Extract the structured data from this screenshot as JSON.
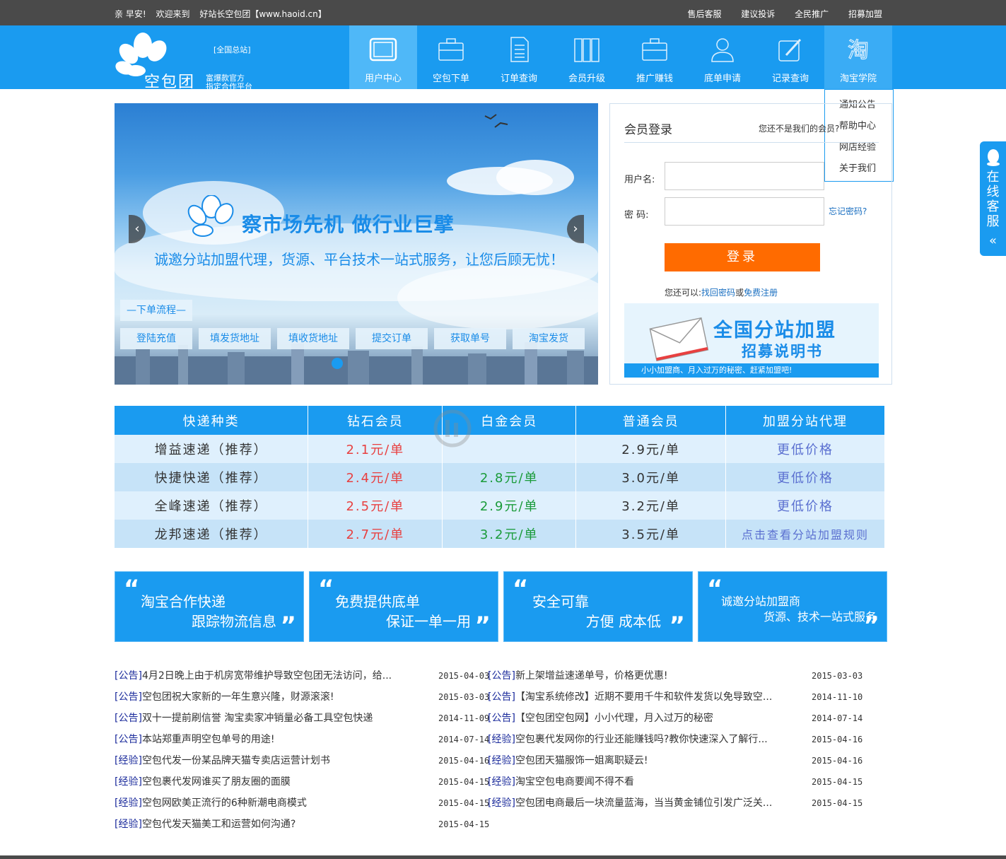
{
  "topbar": {
    "greet": [
      "亲 早安!",
      "欢迎来到",
      "好站长空包团【www.haoid.cn】"
    ],
    "links": [
      "售后客服",
      "建议投诉",
      "全民推广",
      "招募加盟"
    ]
  },
  "logo": {
    "station": "[全国总站]",
    "brand": "空包团",
    "slogan1": "富爆款官方",
    "slogan2": "指定合作平台"
  },
  "nav": [
    {
      "label": "用户中心",
      "icon": "tablet-icon"
    },
    {
      "label": "空包下单",
      "icon": "briefcase-icon"
    },
    {
      "label": "订单查询",
      "icon": "document-icon"
    },
    {
      "label": "会员升级",
      "icon": "books-icon"
    },
    {
      "label": "推广赚钱",
      "icon": "briefcase-icon"
    },
    {
      "label": "底单申请",
      "icon": "user-icon"
    },
    {
      "label": "记录查询",
      "icon": "pen-icon"
    },
    {
      "label": "淘宝学院",
      "icon": "taobao-icon"
    }
  ],
  "dropdown": [
    "通知公告",
    "帮助中心",
    "网店经验",
    "关于我们"
  ],
  "banner": {
    "headline": "察市场先机 做行业巨擘",
    "sub": "诚邀分站加盟代理，货源、平台技术一站式服务，让您后顾无忧！",
    "process_title": "—下单流程—",
    "steps": [
      "登陆充值",
      "填发货地址",
      "填收货地址",
      "提交订单",
      "获取单号",
      "淘宝发货"
    ]
  },
  "login": {
    "title": "会员登录",
    "notyet": "您还不是我们的会员?",
    "username_label": "用户名:",
    "password_label": "密  码:",
    "forgot": "忘记密码?",
    "button": "登录",
    "alt_prefix": "您还可以:",
    "alt_link1": "找回密码",
    "alt_or": "或",
    "alt_link2": "免费注册",
    "promo_t1": "全国分站加盟",
    "promo_t2": "招募说明书",
    "promo_strip": "小小加盟商、月入过万的秘密、赶紧加盟吧!"
  },
  "service": {
    "text": "在线客服",
    "chevron": "«"
  },
  "price_table": {
    "headers": [
      "快递种类",
      "钻石会员",
      "白金会员",
      "普通会员",
      "加盟分站代理"
    ],
    "rows": [
      [
        "增益速递（推荐）",
        "2.1元/单",
        "",
        "2.9元/单",
        "更低价格"
      ],
      [
        "快捷快递（推荐）",
        "2.4元/单",
        "2.8元/单",
        "3.0元/单",
        "更低价格"
      ],
      [
        "全峰速递（推荐）",
        "2.5元/单",
        "2.9元/单",
        "3.2元/单",
        "更低价格"
      ],
      [
        "龙邦速递（推荐）",
        "2.7元/单",
        "3.2元/单",
        "3.5元/单",
        "点击查看分站加盟规则"
      ]
    ]
  },
  "features": [
    {
      "l1": "淘宝合作快递",
      "l2": "跟踪物流信息"
    },
    {
      "l1": "免费提供底单",
      "l2": "保证一单一用"
    },
    {
      "l1": "安全可靠",
      "l2": "方便 成本低"
    },
    {
      "l1": "诚邀分站加盟商",
      "l2": "货源、技术一站式服务"
    }
  ],
  "news_left": [
    {
      "tag": "[公告]",
      "text": "4月2日晚上由于机房宽带维护导致空包团无法访问，给...",
      "date": "2015-04-03"
    },
    {
      "tag": "[公告]",
      "text": "空包团祝大家新的一年生意兴隆，财源滚滚!",
      "date": "2015-03-03"
    },
    {
      "tag": "[公告]",
      "text": "双十一提前刷信誉 淘宝卖家冲销量必备工具空包快递",
      "date": "2014-11-09"
    },
    {
      "tag": "[公告]",
      "text": "本站郑重声明空包单号的用途!",
      "date": "2014-07-14"
    },
    {
      "tag": "[经验]",
      "text": "空包代发一份某品牌天猫专卖店运营计划书",
      "date": "2015-04-16"
    },
    {
      "tag": "[经验]",
      "text": "空包裹代发网谁买了朋友圈的面膜",
      "date": "2015-04-15"
    },
    {
      "tag": "[经验]",
      "text": "空包网欧美正流行的6种新潮电商模式",
      "date": "2015-04-15"
    },
    {
      "tag": "[经验]",
      "text": "空包代发天猫美工和运营如何沟通?",
      "date": "2015-04-15"
    }
  ],
  "news_right": [
    {
      "tag": "[公告]",
      "text": "新上架增益速递单号，价格更优惠!",
      "date": "2015-03-03"
    },
    {
      "tag": "[公告]",
      "text": "【淘宝系统修改】近期不要用千牛和软件发货以免导致空...",
      "date": "2014-11-10"
    },
    {
      "tag": "[公告]",
      "text": "【空包团空包网】小小代理，月入过万的秘密",
      "date": "2014-07-14"
    },
    {
      "tag": "[经验]",
      "text": "空包裹代发网你的行业还能赚钱吗?教你快速深入了解行...",
      "date": "2015-04-16"
    },
    {
      "tag": "[经验]",
      "text": "空包团天猫服饰一姐离职疑云!",
      "date": "2015-04-16"
    },
    {
      "tag": "[经验]",
      "text": "淘宝空包电商要闻不得不看",
      "date": "2015-04-15"
    },
    {
      "tag": "[经验]",
      "text": "空包团电商最后一块流量蓝海，当当黄金铺位引发广泛关...",
      "date": "2015-04-15"
    }
  ],
  "colors": {
    "primary": "#1a9bf0",
    "login_button": "#ff6b00",
    "topbar": "#4a4a4a"
  }
}
